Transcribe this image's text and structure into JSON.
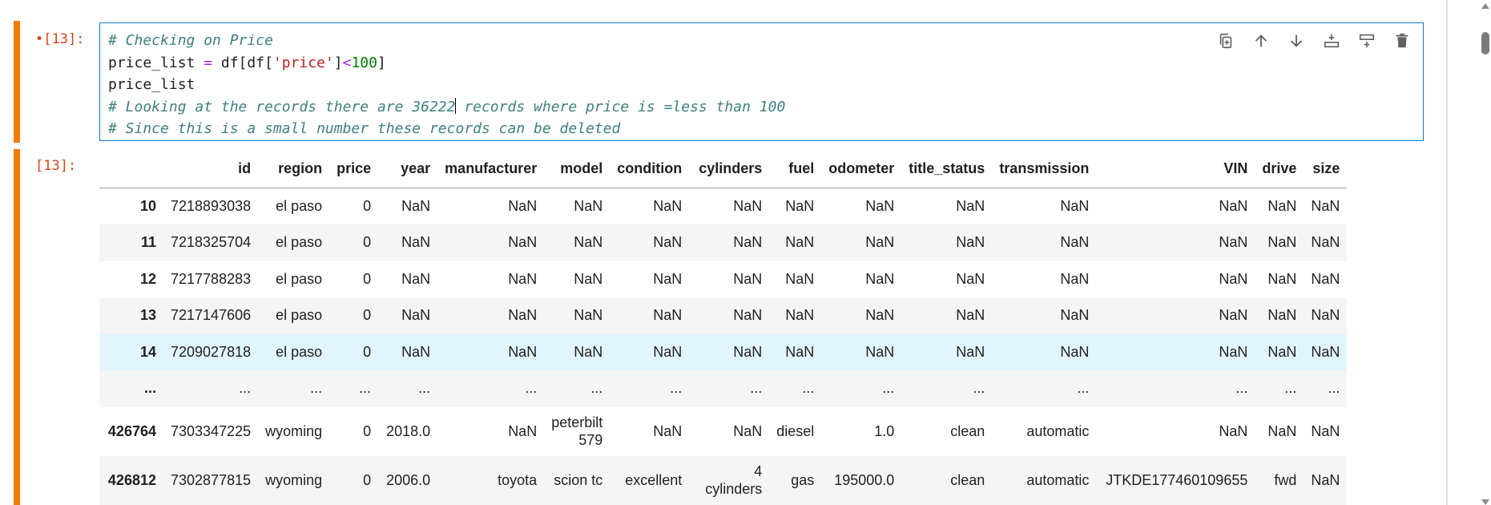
{
  "input_cell": {
    "prompt": "•[13]:",
    "code": {
      "line1_comment": "# Checking on Price",
      "line2": {
        "var": "price_list",
        "eq": " = ",
        "df1": "df[df[",
        "str": "'price'",
        "br": "]",
        "lt": "<",
        "num": "100",
        "close": "]"
      },
      "line3": "price_list",
      "line4_before_cursor": "# Looking at the records there are 36222",
      "line4_after_cursor": " records where price is =less than 100",
      "line5_comment": "# Since this is a small number these records can be deleted"
    },
    "toolbar": [
      "duplicate-icon",
      "move-up-icon",
      "move-down-icon",
      "insert-above-icon",
      "insert-below-icon",
      "delete-icon"
    ]
  },
  "output_cell": {
    "prompt": "[13]:",
    "columns": [
      "",
      "id",
      "region",
      "price",
      "year",
      "manufacturer",
      "model",
      "condition",
      "cylinders",
      "fuel",
      "odometer",
      "title_status",
      "transmission",
      "VIN",
      "drive",
      "size"
    ],
    "rows": [
      [
        "10",
        "7218893038",
        "el paso",
        "0",
        "NaN",
        "NaN",
        "NaN",
        "NaN",
        "NaN",
        "NaN",
        "NaN",
        "NaN",
        "NaN",
        "NaN",
        "NaN",
        "NaN"
      ],
      [
        "11",
        "7218325704",
        "el paso",
        "0",
        "NaN",
        "NaN",
        "NaN",
        "NaN",
        "NaN",
        "NaN",
        "NaN",
        "NaN",
        "NaN",
        "NaN",
        "NaN",
        "NaN"
      ],
      [
        "12",
        "7217788283",
        "el paso",
        "0",
        "NaN",
        "NaN",
        "NaN",
        "NaN",
        "NaN",
        "NaN",
        "NaN",
        "NaN",
        "NaN",
        "NaN",
        "NaN",
        "NaN"
      ],
      [
        "13",
        "7217147606",
        "el paso",
        "0",
        "NaN",
        "NaN",
        "NaN",
        "NaN",
        "NaN",
        "NaN",
        "NaN",
        "NaN",
        "NaN",
        "NaN",
        "NaN",
        "NaN"
      ],
      [
        "14",
        "7209027818",
        "el paso",
        "0",
        "NaN",
        "NaN",
        "NaN",
        "NaN",
        "NaN",
        "NaN",
        "NaN",
        "NaN",
        "NaN",
        "NaN",
        "NaN",
        "NaN"
      ],
      [
        "...",
        "...",
        "...",
        "...",
        "...",
        "...",
        "...",
        "...",
        "...",
        "...",
        "...",
        "...",
        "...",
        "...",
        "...",
        "..."
      ],
      [
        "426764",
        "7303347225",
        "wyoming",
        "0",
        "2018.0",
        "NaN",
        "peterbilt 579",
        "NaN",
        "NaN",
        "diesel",
        "1.0",
        "clean",
        "automatic",
        "NaN",
        "NaN",
        "NaN"
      ],
      [
        "426812",
        "7302877815",
        "wyoming",
        "0",
        "2006.0",
        "toyota",
        "scion tc",
        "excellent",
        "4 cylinders",
        "gas",
        "195000.0",
        "clean",
        "automatic",
        "JTKDE177460109655",
        "fwd",
        "NaN"
      ]
    ]
  }
}
